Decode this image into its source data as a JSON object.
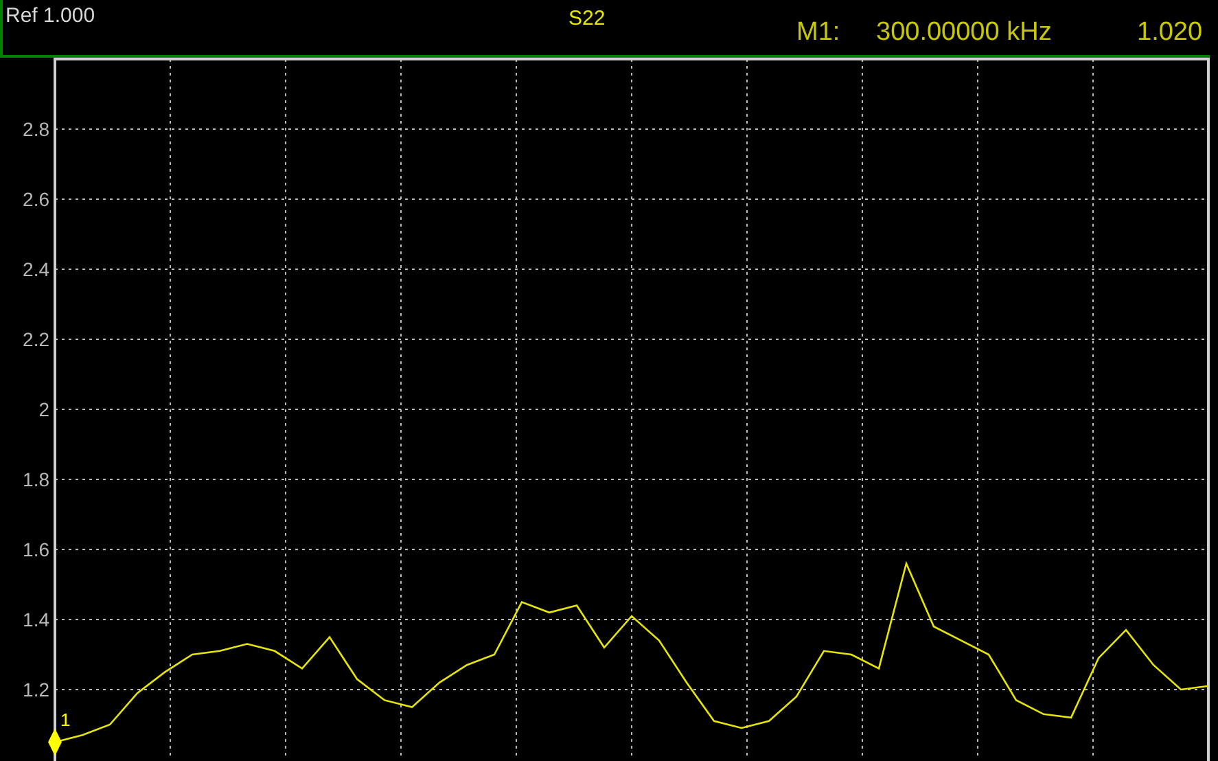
{
  "header": {
    "reference": "Ref 1.000",
    "trace": "S22",
    "marker_label": "M1:",
    "marker_frequency": "300.00000 kHz",
    "marker_value": "1.020"
  },
  "plot": {
    "marker": {
      "label": "1"
    },
    "chart_data": {
      "type": "line",
      "ylim": [
        1,
        3
      ],
      "yticks": [
        1.2,
        1.4,
        1.6,
        1.8,
        2,
        2.2,
        2.4,
        2.6,
        2.8
      ],
      "grid": true,
      "series": [
        {
          "color": "#e6e600",
          "values": [
            1.05,
            1.07,
            1.1,
            1.19,
            1.25,
            1.3,
            1.31,
            1.33,
            1.31,
            1.26,
            1.35,
            1.23,
            1.17,
            1.15,
            1.22,
            1.27,
            1.3,
            1.45,
            1.42,
            1.44,
            1.32,
            1.41,
            1.34,
            1.22,
            1.11,
            1.09,
            1.11,
            1.18,
            1.31,
            1.3,
            1.26,
            1.56,
            1.38,
            1.34,
            1.3,
            1.17,
            1.13,
            1.12,
            1.29,
            1.37,
            1.27,
            1.2,
            1.21
          ]
        }
      ]
    }
  }
}
